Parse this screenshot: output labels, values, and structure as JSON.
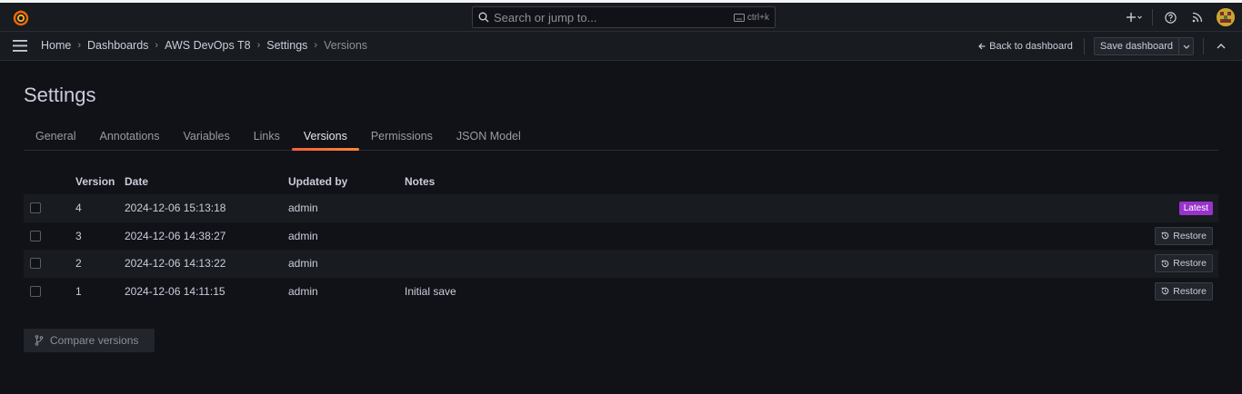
{
  "topbar": {
    "search_placeholder": "Search or jump to...",
    "search_shortcut": "ctrl+k"
  },
  "breadcrumb": [
    "Home",
    "Dashboards",
    "AWS DevOps T8",
    "Settings",
    "Versions"
  ],
  "nav_actions": {
    "back_label": "Back to dashboard",
    "save_label": "Save dashboard"
  },
  "page": {
    "title": "Settings"
  },
  "tabs": [
    {
      "label": "General",
      "active": false
    },
    {
      "label": "Annotations",
      "active": false
    },
    {
      "label": "Variables",
      "active": false
    },
    {
      "label": "Links",
      "active": false
    },
    {
      "label": "Versions",
      "active": true
    },
    {
      "label": "Permissions",
      "active": false
    },
    {
      "label": "JSON Model",
      "active": false
    }
  ],
  "versions_table": {
    "headers": {
      "version": "Version",
      "date": "Date",
      "updated_by": "Updated by",
      "notes": "Notes"
    },
    "rows": [
      {
        "version": "4",
        "date": "2024-12-06 15:13:18",
        "updated_by": "admin",
        "notes": "",
        "action": "Latest"
      },
      {
        "version": "3",
        "date": "2024-12-06 14:38:27",
        "updated_by": "admin",
        "notes": "",
        "action": "Restore"
      },
      {
        "version": "2",
        "date": "2024-12-06 14:13:22",
        "updated_by": "admin",
        "notes": "",
        "action": "Restore"
      },
      {
        "version": "1",
        "date": "2024-12-06 14:11:15",
        "updated_by": "admin",
        "notes": "Initial save",
        "action": "Restore"
      }
    ]
  },
  "compare_label": "Compare versions",
  "colors": {
    "accent_orange": "#f55f3e",
    "badge_purple": "#9933cc",
    "background": "#111217",
    "panel": "#181b1f"
  }
}
